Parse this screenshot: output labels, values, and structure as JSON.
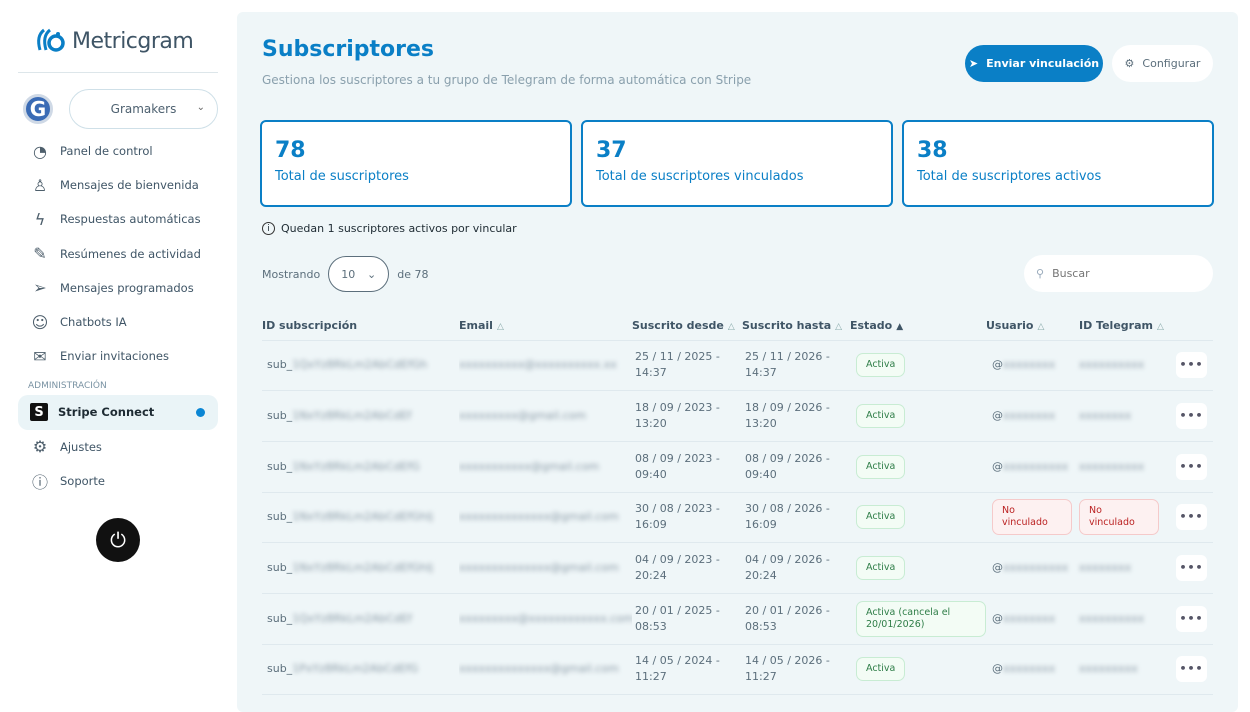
{
  "brand": "Metricgram",
  "group": {
    "avatar_letter": "G",
    "selected": "Gramakers"
  },
  "nav": [
    {
      "label": "Panel de control",
      "icon": "gauge-icon",
      "glyph": "◔"
    },
    {
      "label": "Mensajes de bienvenida",
      "icon": "person-icon",
      "glyph": "♙"
    },
    {
      "label": "Respuestas automáticas",
      "icon": "bolt-icon",
      "glyph": "ϟ"
    },
    {
      "label": "Resúmenes de actividad",
      "icon": "edit-icon",
      "glyph": "✎"
    },
    {
      "label": "Mensajes programados",
      "icon": "send-clock-icon",
      "glyph": "➢"
    },
    {
      "label": "Chatbots IA",
      "icon": "robot-icon",
      "glyph": "☺"
    },
    {
      "label": "Enviar invitaciones",
      "icon": "envelope-icon",
      "glyph": "✉"
    }
  ],
  "admin_section": "ADMINISTRACIÓN",
  "admin_nav": [
    {
      "label": "Stripe Connect",
      "icon": "stripe-icon",
      "glyph": "S"
    },
    {
      "label": "Ajustes",
      "icon": "gear-icon",
      "glyph": "⚙"
    },
    {
      "label": "Soporte",
      "icon": "info-icon",
      "glyph": "ⓘ"
    }
  ],
  "header": {
    "title": "Subscriptores",
    "subtitle": "Gestiona los suscriptores a tu grupo de Telegram de forma automática con Stripe",
    "send_button": "Enviar vinculación",
    "config_button": "Configurar"
  },
  "stats": [
    {
      "value": "78",
      "label": "Total de suscriptores"
    },
    {
      "value": "37",
      "label": "Total de suscriptores vinculados"
    },
    {
      "value": "38",
      "label": "Total de suscriptores activos"
    }
  ],
  "notice": "Quedan 1 suscriptores activos por vincular",
  "pagination": {
    "showing": "Mostrando",
    "page_size": "10",
    "of": "de 78"
  },
  "search": {
    "placeholder": "Buscar"
  },
  "columns": [
    "ID subscripción",
    "Email",
    "Suscrito desde",
    "Suscrito hasta",
    "Estado",
    "Usuario",
    "ID Telegram"
  ],
  "rows": [
    {
      "id": "sub_",
      "id_blur": "1QxYz8RkLm2AbCdEfGh",
      "email": "xxxxxxxxxx@xxxxxxxxxx.xx",
      "from": "25 / 11 / 2025 - 14:37",
      "to": "25 / 11 / 2026 - 14:37",
      "status": "Activa",
      "user": "@",
      "user_blur": "xxxxxxxx",
      "tg": "xxxxxxxxxx"
    },
    {
      "id": "sub_",
      "id_blur": "1NxYz8RkLm2AbCdEf",
      "email": "xxxxxxxxx@gmail.com",
      "from": "18 / 09 / 2023 - 13:20",
      "to": "18 / 09 / 2026 - 13:20",
      "status": "Activa",
      "user": "@",
      "user_blur": "xxxxxxxx",
      "tg": "xxxxxxxx"
    },
    {
      "id": "sub_",
      "id_blur": "1NxYz8RkLm2AbCdEfG",
      "email": "xxxxxxxxxxx@gmail.com",
      "from": "08 / 09 / 2023 - 09:40",
      "to": "08 / 09 / 2026 - 09:40",
      "status": "Activa",
      "user": "@",
      "user_blur": "xxxxxxxxxx",
      "tg": "xxxxxxxxxx"
    },
    {
      "id": "sub_",
      "id_blur": "1NxYz8RkLm2AbCdEfGhIj",
      "email": "xxxxxxxxxxxxxx@gmail.com",
      "from": "30 / 08 / 2023 - 16:09",
      "to": "30 / 08 / 2026 - 16:09",
      "status": "Activa",
      "user": "No vinculado",
      "tg": "No vinculado",
      "unlinked": true
    },
    {
      "id": "sub_",
      "id_blur": "1NxYz8RkLm2AbCdEfGhIj",
      "email": "xxxxxxxxxxxxxx@gmail.com",
      "from": "04 / 09 / 2023 - 20:24",
      "to": "04 / 09 / 2026 - 20:24",
      "status": "Activa",
      "user": "@",
      "user_blur": "xxxxxxxxxx",
      "tg": "xxxxxxxx"
    },
    {
      "id": "sub_",
      "id_blur": "1QxYz8RkLm2AbCdEf",
      "email": "xxxxxxxxx@xxxxxxxxxxxx.com",
      "from": "20 / 01 / 2025 - 08:53",
      "to": "20 / 01 / 2026 - 08:53",
      "status": "Activa (cancela el 20/01/2026)",
      "user": "@",
      "user_blur": "xxxxxxxx",
      "tg": "xxxxxxxxxx"
    },
    {
      "id": "sub_",
      "id_blur": "1PxYz8RkLm2AbCdEfG",
      "email": "xxxxxxxxxxxxxx@gmail.com",
      "from": "14 / 05 / 2024 - 11:27",
      "to": "14 / 05 / 2026 - 11:27",
      "status": "Activa",
      "user": "@",
      "user_blur": "xxxxxxxx",
      "tg": "xxxxxxxxx"
    }
  ],
  "colors": {
    "accent": "#0a7fc6",
    "panel": "#eff6f8",
    "active_green": "#2e7d47",
    "unlinked_red": "#b22222"
  }
}
